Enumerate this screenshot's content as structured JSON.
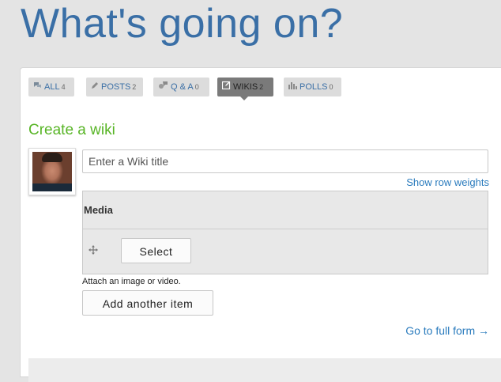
{
  "page": {
    "title": "What's going on?"
  },
  "tabs": [
    {
      "label": "ALL",
      "count": "4",
      "icon": "comments-icon",
      "active": false
    },
    {
      "label": "POSTS",
      "count": "2",
      "icon": "pencil-icon",
      "active": false
    },
    {
      "label": "Q & A",
      "count": "0",
      "icon": "question-icon",
      "active": false
    },
    {
      "label": "WIKIS",
      "count": "2",
      "icon": "edit-icon",
      "active": true
    },
    {
      "label": "POLLS",
      "count": "0",
      "icon": "bar-chart-icon",
      "active": false
    }
  ],
  "form": {
    "heading": "Create a wiki",
    "title_placeholder": "Enter a Wiki title",
    "title_value": "",
    "show_row_weights": "Show row weights",
    "media": {
      "header": "Media",
      "select_label": "Select",
      "help": "Attach an image or video.",
      "add_another_label": "Add another item"
    },
    "full_form_link": "Go to full form →"
  },
  "colors": {
    "title_blue": "#3a6fa6",
    "link_blue": "#2a7bbd",
    "heading_green": "#58b526",
    "active_tab_bg": "#7a7a7a"
  }
}
